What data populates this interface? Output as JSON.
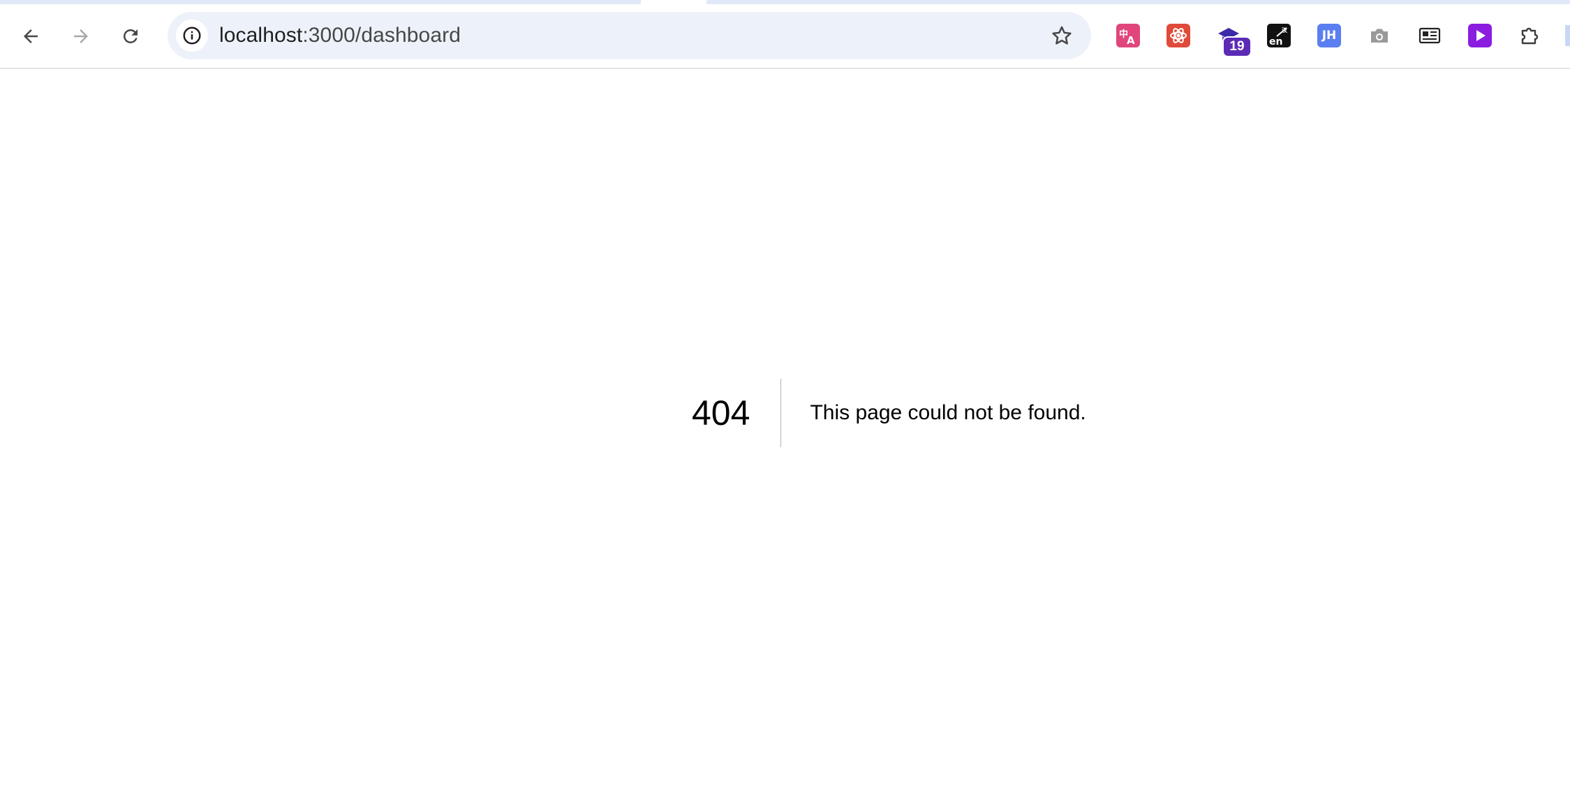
{
  "browser": {
    "url_host": "localhost",
    "url_path": ":3000/dashboard",
    "nav": {
      "back_icon": "arrow-left-icon",
      "forward_icon": "arrow-right-icon",
      "reload_icon": "reload-icon"
    },
    "site_info_icon": "info-circle-icon",
    "bookmark_icon": "star-outline-icon",
    "extensions": [
      {
        "name": "translate-extension-icon",
        "glyph": "文A",
        "color": "#e0457b"
      },
      {
        "name": "atom-extension-icon",
        "glyph": "✦",
        "color": "#e04a3a"
      },
      {
        "name": "graduation-cap-extension-icon",
        "glyph": "",
        "color": "#3d2aa8",
        "badge": "19"
      },
      {
        "name": "dictionary-extension-icon",
        "glyph": "en",
        "color": "#111111"
      },
      {
        "name": "jh-extension-icon",
        "glyph": "JH",
        "color": "#5b7ef0"
      },
      {
        "name": "camera-extension-icon",
        "glyph": "",
        "color": "#9a9a9a"
      },
      {
        "name": "reader-extension-icon",
        "glyph": "",
        "color": "#222222"
      },
      {
        "name": "play-extension-icon",
        "glyph": "▶",
        "color": "#8a1de0"
      },
      {
        "name": "puzzle-extensions-icon",
        "glyph": "",
        "color": "#3c3c3c"
      }
    ]
  },
  "page": {
    "error_code": "404",
    "error_message": "This page could not be found."
  }
}
